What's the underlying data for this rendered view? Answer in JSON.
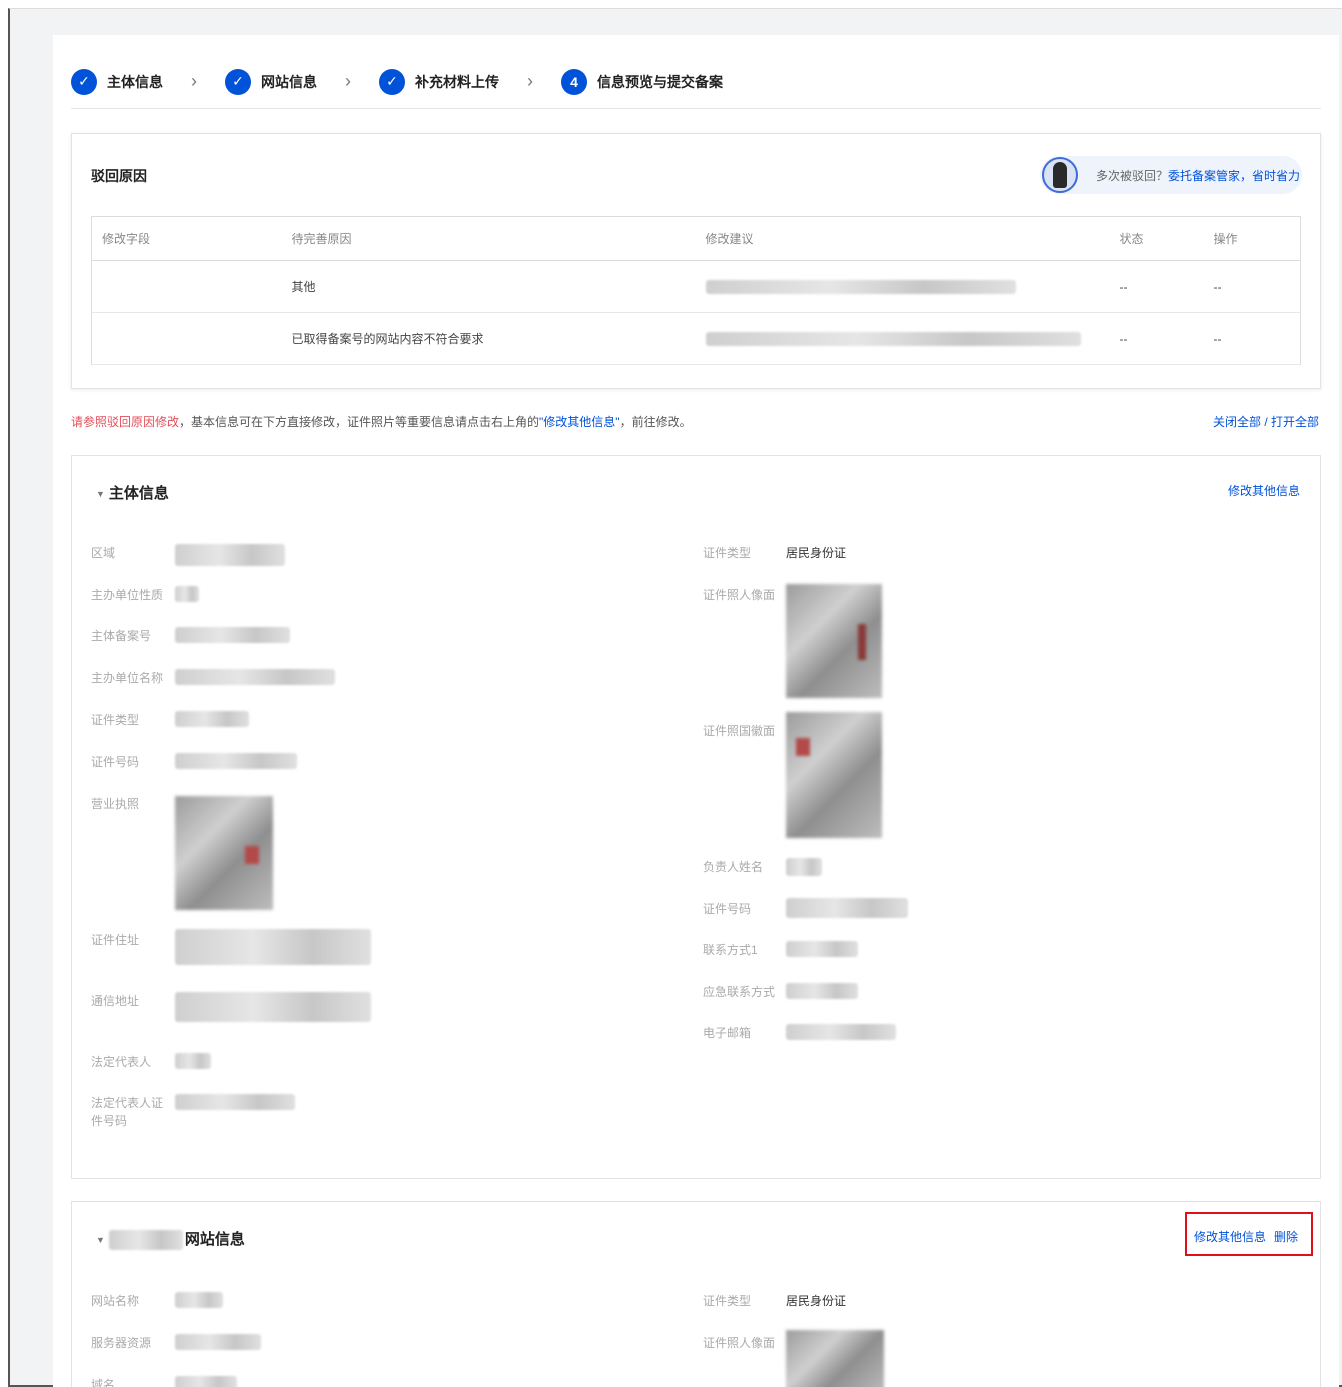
{
  "steps": [
    {
      "icon": "✓",
      "label": "主体信息"
    },
    {
      "icon": "✓",
      "label": "网站信息"
    },
    {
      "icon": "✓",
      "label": "补充材料上传"
    },
    {
      "icon": "4",
      "label": "信息预览与提交备案"
    }
  ],
  "reject": {
    "title": "驳回原因",
    "helper_text": "多次被驳回？",
    "helper_link": "委托备案管家，省时省力",
    "columns": [
      "修改字段",
      "待完善原因",
      "修改建议",
      "状态",
      "操作"
    ],
    "rows": [
      {
        "field": "",
        "reason": "其他",
        "status": "--",
        "action": "--"
      },
      {
        "field": "",
        "reason": "已取得备案号的网站内容不符合要求",
        "status": "--",
        "action": "--"
      }
    ]
  },
  "notice": {
    "red": "请参照驳回原因修改",
    "text1": "，基本信息可在下方直接修改，证件照片等重要信息请点击右上角的",
    "link": "\"修改其他信息\"",
    "text2": "，前往修改。"
  },
  "toggle_all": "关闭全部 / 打开全部",
  "subject": {
    "title": "主体信息",
    "action": "修改其他信息",
    "left_labels": [
      "区域",
      "主办单位性质",
      "主体备案号",
      "主办单位名称",
      "证件类型",
      "证件号码",
      "营业执照",
      "证件住址",
      "通信地址",
      "法定代表人",
      "法定代表人证件号码"
    ],
    "right_labels": [
      "证件类型",
      "证件照人像面",
      "证件照国徽面",
      "负责人姓名",
      "证件号码",
      "联系方式1",
      "应急联系方式",
      "电子邮箱"
    ],
    "id_type_value": "居民身份证"
  },
  "website": {
    "title": "网站信息",
    "action_edit": "修改其他信息",
    "action_delete": "删除",
    "left_labels": [
      "网站名称",
      "服务器资源",
      "域名"
    ],
    "right_labels": [
      "证件类型",
      "证件照人像面"
    ],
    "id_type_value": "居民身份证"
  }
}
